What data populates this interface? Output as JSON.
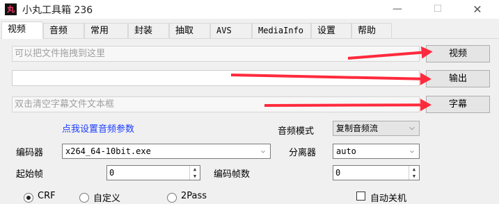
{
  "window": {
    "icon_text": "丸",
    "title": "小丸工具箱 236",
    "minimize": "—",
    "maximize": "☐",
    "close": "✕"
  },
  "tabs": [
    {
      "label": "视频",
      "active": true
    },
    {
      "label": "音频"
    },
    {
      "label": "常用"
    },
    {
      "label": "封装"
    },
    {
      "label": "抽取"
    },
    {
      "label": "AVS"
    },
    {
      "label": "MediaInfo"
    },
    {
      "label": "设置"
    },
    {
      "label": "帮助"
    }
  ],
  "video": {
    "video_input_placeholder": "可以把文件拖拽到这里",
    "video_button": "视频",
    "output_value": "",
    "output_button": "输出",
    "subtitle_placeholder": "双击清空字幕文件文本框",
    "subtitle_button": "字幕",
    "audio_settings_link": "点我设置音频参数",
    "audio_mode_label": "音频模式",
    "audio_mode_value": "复制音频流",
    "encoder_label": "编码器",
    "encoder_value": "x264_64-10bit.exe",
    "splitter_label": "分离器",
    "splitter_value": "auto",
    "start_frame_label": "起始帧",
    "start_frame_value": "0",
    "encode_frames_label": "编码帧数",
    "encode_frames_value": "0",
    "radio_options": [
      "CRF",
      "自定义",
      "2Pass"
    ],
    "auto_shutdown_label": "自动关机"
  },
  "colors": {
    "annotation_arrow": "#ff2a3d",
    "link": "#1a3cff"
  }
}
